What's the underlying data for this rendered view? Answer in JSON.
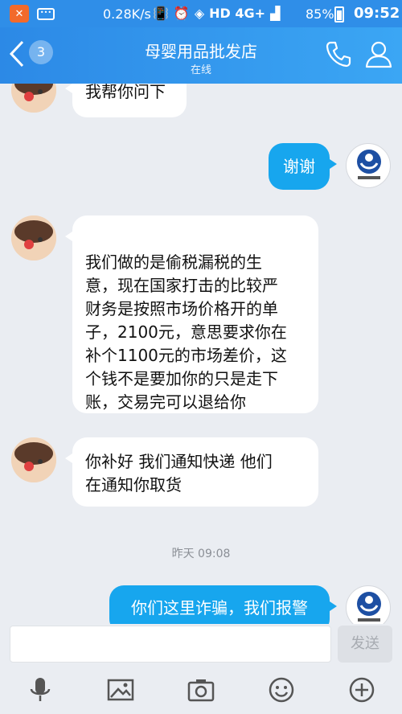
{
  "status_bar": {
    "network_speed": "0.28K/s",
    "network_type": "HD 4G+",
    "battery": "85%",
    "time": "09:52"
  },
  "header": {
    "back_icon": "back-chevron-icon",
    "unread_count": "3",
    "title": "母婴用品批发店",
    "subtitle": "在线",
    "call_icon": "phone-icon",
    "profile_icon": "user-icon"
  },
  "messages": [
    {
      "side": "left",
      "text": "我帮你问下"
    },
    {
      "side": "right",
      "text": "谢谢"
    },
    {
      "side": "left",
      "lines": [
        "我们做的是偷税漏税的生",
        "意，现在国家打击的比较严",
        "财务是按照市场价格开的单",
        "子，2100元，意思要求你在",
        "补个1100元的市场差价，这",
        "个钱不是要加你的只是走下",
        "账，交易完可以退给你"
      ]
    },
    {
      "side": "left",
      "lines": [
        "你补好 我们通知快递  他们",
        "在通知你取货"
      ]
    },
    {
      "side": "timestamp",
      "text": "昨天 09:08"
    },
    {
      "side": "right",
      "text": "你们这里诈骗，我们报警"
    }
  ],
  "composer": {
    "input_value": "",
    "send_label": "发送"
  },
  "toolbar_icons": [
    "microphone-icon",
    "image-icon",
    "camera-icon",
    "emoji-icon",
    "plus-icon"
  ],
  "colors": {
    "accent": "#2f8ee8",
    "outgoing_bubble": "#17a6ee",
    "background": "#eaedf2"
  }
}
